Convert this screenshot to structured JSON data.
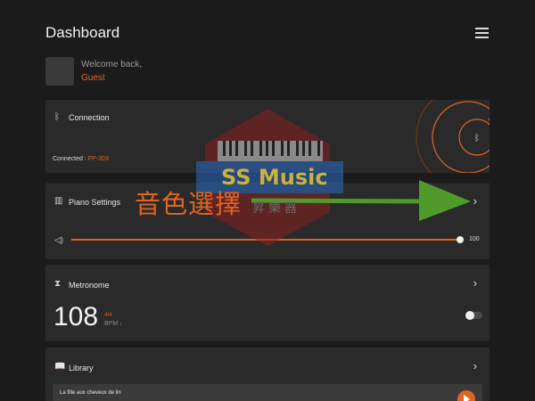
{
  "header": {
    "title": "Dashboard",
    "menu_icon": "hamburger-menu-icon"
  },
  "user": {
    "welcome": "Welcome back,",
    "name": "Guest"
  },
  "connection": {
    "title": "Connection",
    "icon": "bluetooth-icon",
    "status_prefix": "Connected : ",
    "model": "FP-30X"
  },
  "piano": {
    "title": "Piano Settings",
    "icon": "piano-keys-icon",
    "volume_value": "100",
    "volume_fraction": 1.0
  },
  "metronome": {
    "title": "Metronome",
    "icon": "metronome-icon",
    "tempo": "108",
    "time_signature": "4/4",
    "bpm_label": "BPM ♩",
    "enabled": false
  },
  "library": {
    "title": "Library",
    "icon": "book-icon",
    "items": [
      {
        "title": "La fille aux cheveux de lin"
      }
    ]
  },
  "annotation": {
    "text": "音色選擇"
  },
  "watermark": {
    "brand": "SS Music",
    "sub": "昇樂器"
  },
  "colors": {
    "accent": "#e06422",
    "background": "#1b1b1b",
    "card": "#2a2a2a",
    "arrow": "#4f9a2a"
  }
}
